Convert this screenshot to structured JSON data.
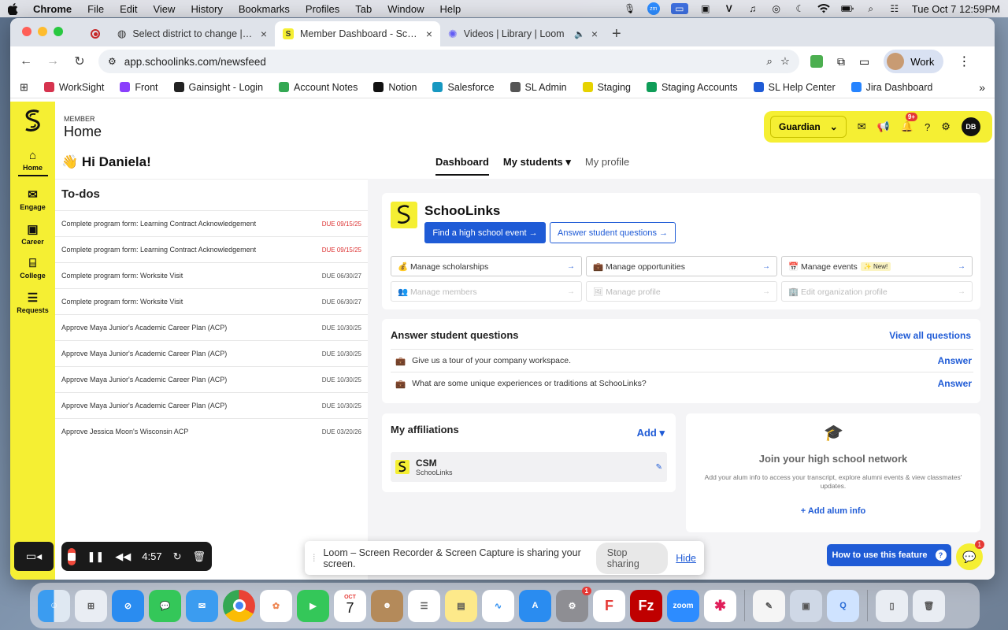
{
  "menubar": {
    "app": "Chrome",
    "items": [
      "File",
      "Edit",
      "View",
      "History",
      "Bookmarks",
      "Profiles",
      "Tab",
      "Window",
      "Help"
    ],
    "clock": "Tue Oct 7  12:59PM"
  },
  "browser": {
    "tabs": [
      {
        "title": "Select district to change | [pr",
        "close": "×"
      },
      {
        "title": "Member Dashboard - SchooL",
        "close": "×"
      },
      {
        "title": "Videos | Library | Loom",
        "close": "×"
      }
    ],
    "new_tab": "+",
    "url": "app.schoolinks.com/newsfeed",
    "profile": "Work"
  },
  "bookmarks": [
    {
      "label": "WorkSight",
      "color": "#d6334e"
    },
    {
      "label": "Front",
      "color": "#8a3ffc"
    },
    {
      "label": "Gainsight - Login",
      "color": "#222222"
    },
    {
      "label": "Account Notes",
      "color": "#34a853"
    },
    {
      "label": "Notion",
      "color": "#111111"
    },
    {
      "label": "Salesforce",
      "color": "#1798c1"
    },
    {
      "label": "SL Admin",
      "color": "#555555"
    },
    {
      "label": "Staging",
      "color": "#e6d200"
    },
    {
      "label": "Staging Accounts",
      "color": "#0f9d58"
    },
    {
      "label": "SL Help Center",
      "color": "#1f5bd6"
    },
    {
      "label": "Jira Dashboard",
      "color": "#2684ff"
    }
  ],
  "leftnav": [
    {
      "label": "Home",
      "icon": "⌂"
    },
    {
      "label": "Engage",
      "icon": "✉"
    },
    {
      "label": "Career",
      "icon": "▣"
    },
    {
      "label": "College",
      "icon": "⌸"
    },
    {
      "label": "Requests",
      "icon": "☰"
    }
  ],
  "header": {
    "member_label": "MEMBER",
    "title": "Home",
    "greeting": "👋 Hi Daniela!",
    "tabs": [
      "Dashboard",
      "My students ▾",
      "My profile"
    ],
    "role": "Guardian",
    "notif_badge": "9+",
    "user_initials": "DB"
  },
  "todos": {
    "title": "To-dos",
    "items": [
      {
        "text": "Complete program form: Learning Contract Acknowledgement",
        "due": "DUE 09/15/25",
        "overdue": true
      },
      {
        "text": "Complete program form: Learning Contract Acknowledgement",
        "due": "DUE 09/15/25",
        "overdue": true
      },
      {
        "text": "Complete program form: Worksite Visit",
        "due": "DUE 06/30/27",
        "overdue": false
      },
      {
        "text": "Complete program form: Worksite Visit",
        "due": "DUE 06/30/27",
        "overdue": false
      },
      {
        "text": "Approve Maya Junior's Academic Career Plan (ACP)",
        "due": "DUE 10/30/25",
        "overdue": false
      },
      {
        "text": "Approve Maya Junior's Academic Career Plan (ACP)",
        "due": "DUE 10/30/25",
        "overdue": false
      },
      {
        "text": "Approve Maya Junior's Academic Career Plan (ACP)",
        "due": "DUE 10/30/25",
        "overdue": false
      },
      {
        "text": "Approve Maya Junior's Academic Career Plan (ACP)",
        "due": "DUE 10/30/25",
        "overdue": false
      },
      {
        "text": "Approve Jessica Moon's Wisconsin ACP",
        "due": "DUE 03/20/26",
        "overdue": false
      }
    ]
  },
  "org": {
    "name": "SchooLinks",
    "primary_btn": "Find a high school event  →",
    "outline_btn": "Answer student questions  →",
    "manage": [
      {
        "label": "💰 Manage scholarships",
        "disabled": false
      },
      {
        "label": "💼 Manage opportunities",
        "disabled": false
      },
      {
        "label": "📅 Manage events",
        "disabled": false,
        "tag": "✨ New!"
      },
      {
        "label": "👥 Manage members",
        "disabled": true
      },
      {
        "label": "🖼 Manage profile",
        "disabled": true
      },
      {
        "label": "🏢 Edit organization profile",
        "disabled": true
      }
    ],
    "arrow": "→"
  },
  "questions": {
    "title": "Answer student questions",
    "view_all": "View all questions",
    "items": [
      {
        "text": "Give us a tour of your company workspace.",
        "action": "Answer"
      },
      {
        "text": "What are some unique experiences or traditions at SchooLinks?",
        "action": "Answer"
      }
    ]
  },
  "affiliations": {
    "title": "My affiliations",
    "add": "Add ▾",
    "item_name": "CSM",
    "item_org": "SchooLinks"
  },
  "join": {
    "title": "Join your high school network",
    "desc": "Add your alum info to access your transcript, explore alumni events & view classmates' updates.",
    "action": "+  Add alum info"
  },
  "loom": {
    "timer": "4:57",
    "share_text": "Loom – Screen Recorder & Screen Capture is sharing your screen.",
    "stop": "Stop sharing",
    "hide": "Hide"
  },
  "help_btn": "How to use this feature",
  "chat_badge": "1",
  "dock": {
    "calendar_month": "OCT",
    "calendar_day": "7",
    "settings_badge": "1",
    "zoom_label": "zoom"
  }
}
